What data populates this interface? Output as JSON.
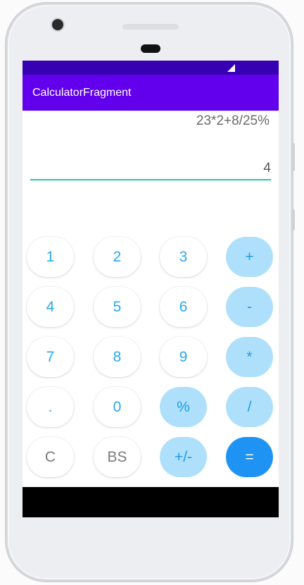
{
  "app": {
    "title": "CalculatorFragment"
  },
  "display": {
    "expression": "23*2+8/25%",
    "result": "4"
  },
  "keypad": {
    "rows": [
      [
        {
          "label": "1",
          "style": "num",
          "name": "key-1"
        },
        {
          "label": "2",
          "style": "num",
          "name": "key-2"
        },
        {
          "label": "3",
          "style": "num",
          "name": "key-3"
        },
        {
          "label": "+",
          "style": "op",
          "name": "key-add"
        }
      ],
      [
        {
          "label": "4",
          "style": "num",
          "name": "key-4"
        },
        {
          "label": "5",
          "style": "num",
          "name": "key-5"
        },
        {
          "label": "6",
          "style": "num",
          "name": "key-6"
        },
        {
          "label": "-",
          "style": "op",
          "name": "key-subtract"
        }
      ],
      [
        {
          "label": "7",
          "style": "num",
          "name": "key-7"
        },
        {
          "label": "8",
          "style": "num",
          "name": "key-8"
        },
        {
          "label": "9",
          "style": "num",
          "name": "key-9"
        },
        {
          "label": "*",
          "style": "op",
          "name": "key-multiply"
        }
      ],
      [
        {
          "label": ".",
          "style": "num",
          "name": "key-decimal"
        },
        {
          "label": "0",
          "style": "num",
          "name": "key-0"
        },
        {
          "label": "%",
          "style": "op",
          "name": "key-percent"
        },
        {
          "label": "/",
          "style": "op",
          "name": "key-divide"
        }
      ],
      [
        {
          "label": "C",
          "style": "grey",
          "name": "key-clear"
        },
        {
          "label": "BS",
          "style": "grey",
          "name": "key-backspace"
        },
        {
          "label": "+/-",
          "style": "op",
          "name": "key-toggle-sign"
        },
        {
          "label": "=",
          "style": "equals",
          "name": "key-equals"
        }
      ]
    ]
  },
  "colors": {
    "status_bar": "#3700b3",
    "app_bar": "#6200ee",
    "accent_underline": "#26c6b0",
    "key_text": "#29a8f0",
    "operator_bg": "#aee0fb",
    "equals_bg": "#1f93f3"
  },
  "icons": {
    "status_signal": "cell-signal-icon"
  }
}
